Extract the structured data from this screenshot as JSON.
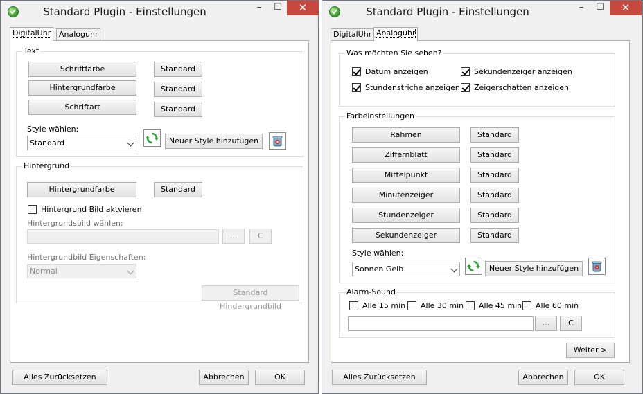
{
  "left": {
    "title": "Standard Plugin - Einstellungen",
    "tabs": [
      "DigitalUhr",
      "Analoguhr"
    ],
    "text_group": {
      "title": "Text",
      "rows": [
        {
          "label": "Schriftfarbe",
          "reset": "Standard"
        },
        {
          "label": "Hintergrundfarbe",
          "reset": "Standard"
        },
        {
          "label": "Schriftart",
          "reset": "Standard"
        }
      ],
      "style_label": "Style wählen:",
      "style_value": "Standard",
      "add_style": "Neuer Style hinzufügen"
    },
    "bg_group": {
      "title": "Hintergrund",
      "color_button": "Hintergrundfarbe",
      "reset": "Standard",
      "enable_image": "Hintergrund Bild aktvieren",
      "choose_label": "Hintergrundsbild wählen:",
      "browse": "...",
      "clear": "C",
      "props_label": "Hintergrundbild Eigenschaften:",
      "props_value": "Normal",
      "default_image": "Standard Hindergrundbild"
    },
    "footer": {
      "reset_all": "Alles Zurücksetzen",
      "cancel": "Abbrechen",
      "ok": "OK"
    }
  },
  "right": {
    "title": "Standard Plugin - Einstellungen",
    "tabs": [
      "DigitalUhr",
      "Analoguhr"
    ],
    "show_group": {
      "title": "Was möchten Sie sehen?",
      "options": [
        {
          "label": "Datum anzeigen",
          "checked": true
        },
        {
          "label": "Sekundenzeiger anzeigen",
          "checked": true
        },
        {
          "label": "Stundenstriche anzeigen",
          "checked": true
        },
        {
          "label": "Zeigerschatten anzeigen",
          "checked": true
        }
      ]
    },
    "color_group": {
      "title": "Farbeinstellungen",
      "rows": [
        {
          "label": "Rahmen",
          "reset": "Standard"
        },
        {
          "label": "Ziffernblatt",
          "reset": "Standard"
        },
        {
          "label": "Mittelpunkt",
          "reset": "Standard"
        },
        {
          "label": "Minutenzeiger",
          "reset": "Standard"
        },
        {
          "label": "Stundenzeiger",
          "reset": "Standard"
        },
        {
          "label": "Sekundenzeiger",
          "reset": "Standard"
        }
      ],
      "style_label": "Style wählen:",
      "style_value": "Sonnen Gelb",
      "add_style": "Neuer Style hinzufügen"
    },
    "alarm_group": {
      "title": "Alarm-Sound",
      "options": [
        "Alle 15 min",
        "Alle 30 min",
        "Alle 45 min",
        "Alle 60 min"
      ],
      "browse": "...",
      "clear": "C"
    },
    "next": "Weiter >",
    "footer": {
      "reset_all": "Alles Zurücksetzen",
      "cancel": "Abbrechen",
      "ok": "OK"
    }
  },
  "window_buttons": {
    "minimize": "–",
    "maximize": "☐",
    "close": "✕"
  },
  "icons": {
    "app": "check-circle-icon",
    "refresh": "refresh-icon",
    "delete": "trash-icon"
  }
}
